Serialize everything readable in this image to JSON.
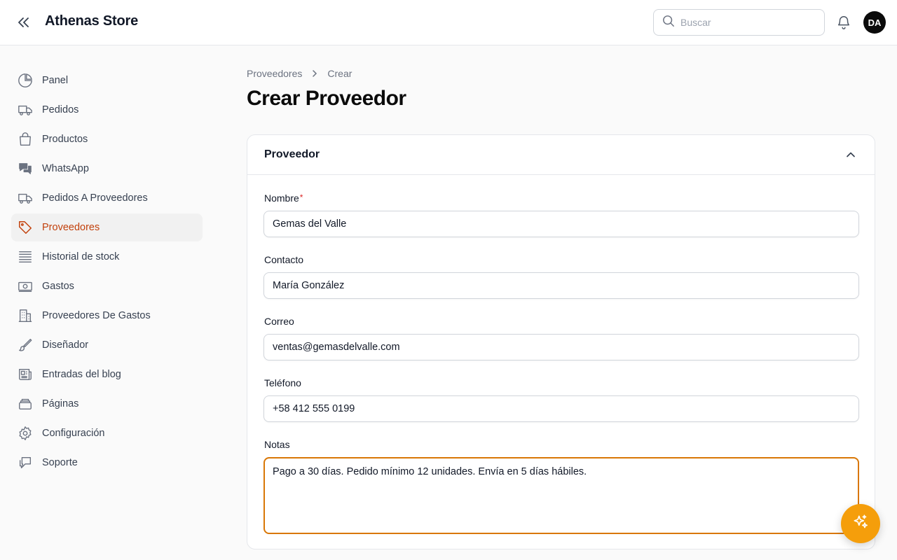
{
  "app": {
    "brand": "Athenas Store"
  },
  "header": {
    "search_placeholder": "Buscar",
    "avatar_initials": "DA"
  },
  "sidebar": {
    "items": [
      {
        "label": "Panel",
        "icon": "pie-chart-icon"
      },
      {
        "label": "Pedidos",
        "icon": "truck-icon"
      },
      {
        "label": "Productos",
        "icon": "shopping-bag-icon"
      },
      {
        "label": "WhatsApp",
        "icon": "chat-bubbles-icon"
      },
      {
        "label": "Pedidos A Proveedores",
        "icon": "truck-icon"
      },
      {
        "label": "Proveedores",
        "icon": "tag-icon",
        "active": true
      },
      {
        "label": "Historial de stock",
        "icon": "lines-icon"
      },
      {
        "label": "Gastos",
        "icon": "banknote-icon"
      },
      {
        "label": "Proveedores De Gastos",
        "icon": "building-icon"
      },
      {
        "label": "Diseñador",
        "icon": "paintbrush-icon"
      },
      {
        "label": "Entradas del blog",
        "icon": "newspaper-icon"
      },
      {
        "label": "Páginas",
        "icon": "stack-icon"
      },
      {
        "label": "Configuración",
        "icon": "gear-icon"
      },
      {
        "label": "Soporte",
        "icon": "chat-icon"
      }
    ]
  },
  "breadcrumb": {
    "parent": "Proveedores",
    "current": "Crear"
  },
  "page": {
    "title": "Crear Proveedor"
  },
  "form": {
    "section_title": "Proveedor",
    "fields": {
      "nombre": {
        "label": "Nombre",
        "required_mark": "*",
        "value": "Gemas del Valle"
      },
      "contacto": {
        "label": "Contacto",
        "value": "María González"
      },
      "correo": {
        "label": "Correo",
        "value": "ventas@gemasdelvalle.com"
      },
      "telefono": {
        "label": "Teléfono",
        "value": "+58 412 555 0199"
      },
      "notas": {
        "label": "Notas",
        "value": "Pago a 30 días. Pedido mínimo 12 unidades. Envía en 5 días hábiles."
      }
    }
  },
  "colors": {
    "accent": "#c2410c",
    "focus": "#d97706",
    "fab": "#f59e0b"
  }
}
